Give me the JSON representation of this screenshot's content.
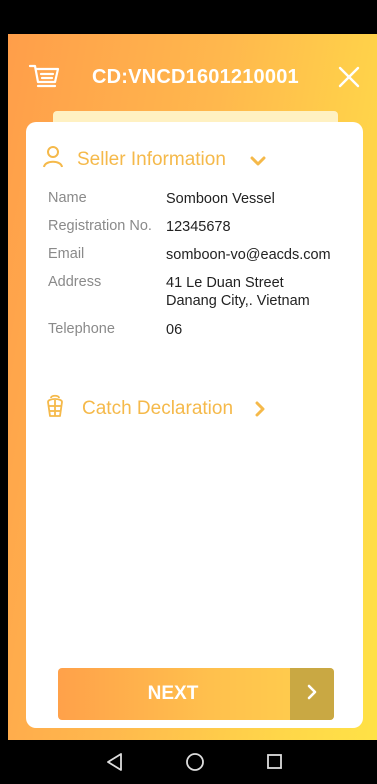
{
  "header": {
    "title": "CD:VNCD1601210001",
    "cart_icon": "cart-icon",
    "close_icon": "close-icon"
  },
  "seller_section": {
    "title": "Seller Information",
    "icon": "person-icon",
    "rows": [
      {
        "label": "Name",
        "value": [
          "Somboon Vessel"
        ]
      },
      {
        "label": "Registration No.",
        "value": [
          "12345678"
        ]
      },
      {
        "label": "Email",
        "value": [
          "somboon-vo@eacds.com"
        ]
      },
      {
        "label": "Address",
        "value": [
          "41 Le Duan Street",
          "Danang City,. Vietnam"
        ]
      },
      {
        "label": "Telephone",
        "value": [
          "06"
        ]
      }
    ]
  },
  "catch_section": {
    "title": "Catch Declaration",
    "icon": "fish-basket-icon"
  },
  "next_button": {
    "label": "NEXT"
  },
  "colors": {
    "accent": "#f5b94a",
    "gradient_start": "#ff9e4a",
    "gradient_end": "#ffe246",
    "button_arrow_bg": "#c9a843"
  }
}
